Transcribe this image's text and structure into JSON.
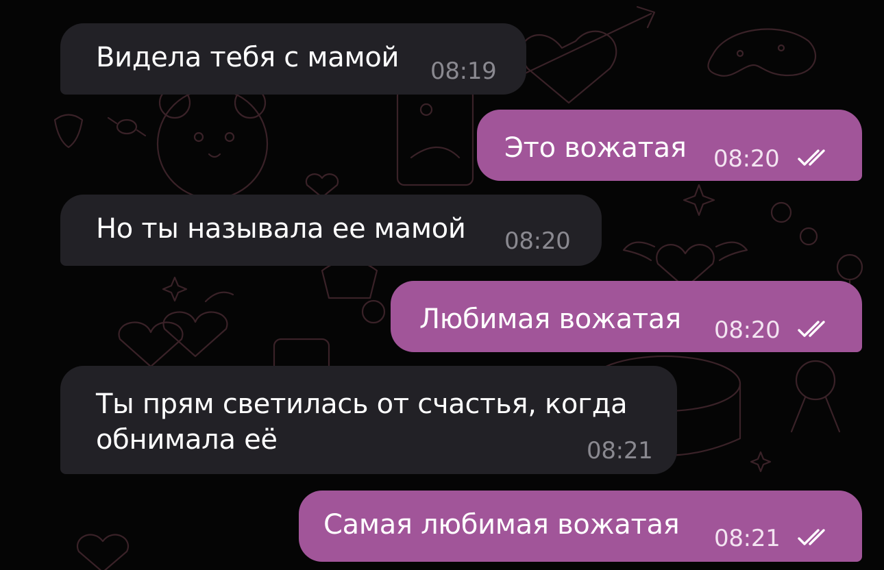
{
  "chat": {
    "messages": [
      {
        "direction": "incoming",
        "text": "Видела тебя с мамой",
        "time": "08:19"
      },
      {
        "direction": "outgoing",
        "text": "Это вожатая",
        "time": "08:20",
        "status_icon": "double-check-icon"
      },
      {
        "direction": "incoming",
        "text": "Но ты называла ее мамой",
        "time": "08:20"
      },
      {
        "direction": "outgoing",
        "text": "Любимая вожатая",
        "time": "08:20",
        "status_icon": "double-check-icon"
      },
      {
        "direction": "incoming",
        "text_lines": [
          "Ты прям светилась от счастья, когда",
          "обнимала её"
        ],
        "time": "08:21"
      },
      {
        "direction": "outgoing",
        "text": "Самая любимая вожатая",
        "time": "08:21",
        "status_icon": "double-check-icon"
      }
    ],
    "colors": {
      "background": "#050505",
      "incoming_bubble": "#222126",
      "outgoing_bubble": "#a15599",
      "doodle_stroke": "#3a2228"
    }
  }
}
